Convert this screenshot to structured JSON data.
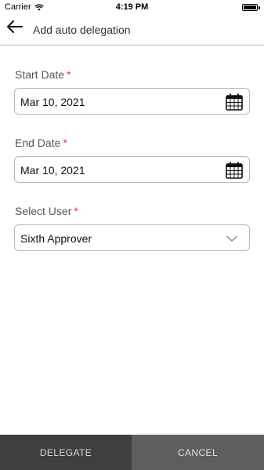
{
  "status_bar": {
    "carrier": "Carrier",
    "time": "4:19 PM"
  },
  "header": {
    "title": "Add auto delegation",
    "back_icon": "arrow-left-icon"
  },
  "form": {
    "start_date": {
      "label": "Start Date",
      "required_marker": "*",
      "value": "Mar 10, 2021",
      "icon": "calendar-icon"
    },
    "end_date": {
      "label": "End Date",
      "required_marker": "*",
      "value": "Mar 10, 2021",
      "icon": "calendar-icon"
    },
    "select_user": {
      "label": "Select User",
      "required_marker": "*",
      "value": "Sixth Approver",
      "icon": "chevron-down-icon"
    }
  },
  "footer": {
    "delegate_label": "DELEGATE",
    "cancel_label": "CANCEL"
  },
  "colors": {
    "required": "#e53935",
    "delegate_bg": "#3f3f3f",
    "cancel_bg": "#5e5e5e"
  }
}
